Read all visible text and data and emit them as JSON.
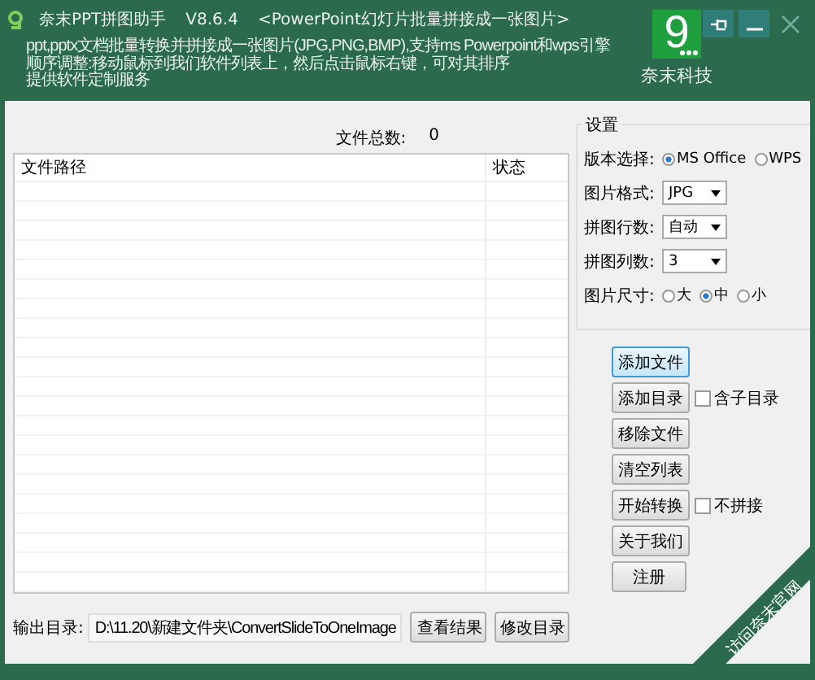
{
  "window": {
    "title": "奈末PPT拼图助手",
    "version": "V8.6.4",
    "subtitle": "<PowerPoint幻灯片批量拼接成一张图片>"
  },
  "description": [
    "ppt,pptx文档批量转换并拼接成一张图片(JPG,PNG,BMP),支持ms Powerpoint和wps引擎",
    "顺序调整:移动鼠标到我们软件列表上，然后点击鼠标右键，可对其排序",
    "提供软件定制服务"
  ],
  "logo": {
    "mark": "9",
    "name": "奈末科技"
  },
  "file_count": {
    "label": "文件总数:",
    "value": "0"
  },
  "table": {
    "columns": [
      "文件路径",
      "状态"
    ]
  },
  "settings": {
    "title": "设置",
    "rows": [
      {
        "kind": "radio",
        "label": "版本选择:",
        "options": [
          {
            "label": "MS Office",
            "selected": true
          },
          {
            "label": "WPS",
            "selected": false
          }
        ]
      },
      {
        "kind": "select",
        "label": "图片格式:",
        "value": "JPG"
      },
      {
        "kind": "select",
        "label": "拼图行数:",
        "value": "自动"
      },
      {
        "kind": "select",
        "label": "拼图列数:",
        "value": "3"
      },
      {
        "kind": "radio",
        "label": "图片尺寸:",
        "options": [
          {
            "label": "大",
            "selected": false
          },
          {
            "label": "中",
            "selected": true
          },
          {
            "label": "小",
            "selected": false
          }
        ]
      }
    ]
  },
  "actions": [
    {
      "label": "添加文件",
      "focused": true
    },
    {
      "label": "添加目录",
      "focused": false,
      "option": {
        "label": "含子目录",
        "checked": false
      }
    },
    {
      "label": "移除文件",
      "focused": false
    },
    {
      "label": "清空列表",
      "focused": false
    },
    {
      "label": "开始转换",
      "focused": false,
      "option": {
        "label": "不拼接",
        "checked": false
      }
    },
    {
      "label": "关于我们",
      "focused": false
    },
    {
      "label": "注册",
      "focused": false
    }
  ],
  "output": {
    "label": "输出目录:",
    "path": "D:\\11.20\\新建文件夹\\ConvertSlideToOneImage",
    "buttons": [
      "查看结果",
      "修改目录"
    ]
  },
  "corner_link": "访问奈末官网"
}
